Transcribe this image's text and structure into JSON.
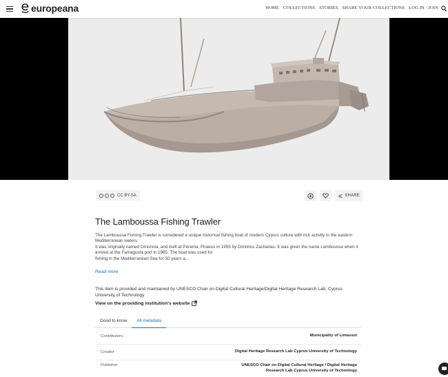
{
  "header": {
    "logo_text": "europeana",
    "nav": [
      "HOME",
      "COLLECTIONS",
      "STORIES",
      "SHARE YOUR COLLECTIONS",
      "LOG IN / JOIN"
    ]
  },
  "item": {
    "license": "CC BY-SA",
    "share_label": "SHARE",
    "title": "The Lamboussa Fishing Trawler",
    "description": [
      "The Lamboussa Fishing Trawler is considered a unique historical fishing boat of modern Cyprus culture with rich activity in the eastern Mediterranean waters.",
      "It was originally named Omonoia, and built at Perama, Piraeus in 1955 by Dimitrios Zacharias. It was given the name Lamboussa when it arrived at the Famagusta port in 1965. The boat was used for",
      "fishing in the Mediterranean Sea for 50 years a..."
    ],
    "read_more": "Read more",
    "provider_text": "This item is provided and maintained by UNESCO Chair on Digital Cultural Heritage/Digital Heritage Research Lab, Cyprus University of Technology.",
    "provider_link": "View on the providing institution's website"
  },
  "tabs": [
    "Good to know",
    "All metadata"
  ],
  "metadata": [
    {
      "label": "Contributors",
      "value": "Municipality of Limassol"
    },
    {
      "label": "Creator",
      "value": "Digital Heritage Research Lab Cyprus University of Technology"
    },
    {
      "label": "Publisher",
      "value_lines": [
        "UNESCO Chair on Digital Cultural Heritage / Digital Heritage",
        "Research Lab Cyprus University of Technology"
      ]
    }
  ],
  "colors": {
    "accent": "#0a72cc",
    "boat": "#b9aba1",
    "viewer_bg": "#000000"
  }
}
